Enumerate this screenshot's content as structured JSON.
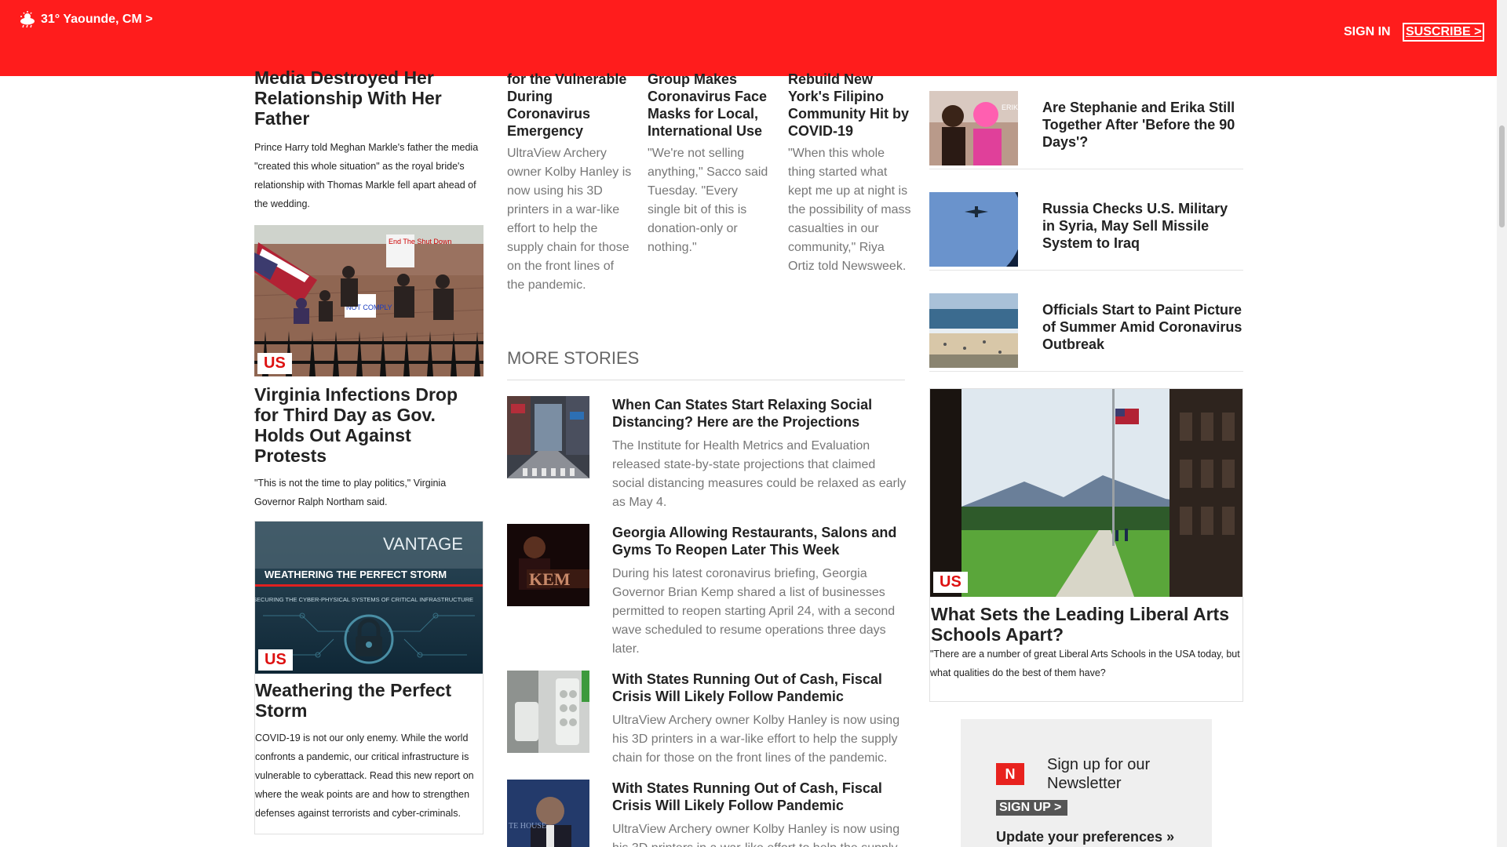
{
  "header": {
    "weather": "31° Yaounde, CM >",
    "sign_in": "SIGN IN",
    "subscribe": "SUSCRIBE >"
  },
  "left": {
    "story1": {
      "title": "Media Destroyed Her Relationship With Her Father",
      "summary": "Prince Harry told Meghan Markle's father the media \"created this whole situation\" as the royal bride's relationship with Thomas Markle fell apart ahead of the wedding."
    },
    "story2": {
      "tag": "US",
      "title": "Virginia Infections Drop for Third Day as Gov. Holds Out Against Protests",
      "summary": "\"This is not the time to play politics,\" Virginia Governor Ralph Northam said.",
      "sign_text": [
        "End The Shut Down",
        "NOT COMPLY"
      ]
    },
    "story3": {
      "tag": "US",
      "title": "Weathering the Perfect Storm",
      "summary": "COVID-19 is not our only enemy. While the world confronts a pandemic, our critical infrastructure is vulnerable to cyberattack. Read this new report on where the weak points are and how to strengthen defenses against terrorists and cyber-criminals.",
      "image_brand": "VANTAGE",
      "image_title": "WEATHERING THE PERFECT STORM",
      "image_subtitle": "SECURING THE CYBER-PHYSICAL SYSTEMS OF CRITICAL INFRASTRUCTURE"
    }
  },
  "middle": {
    "top_stories": [
      {
        "title": "for the Vulnerable During Coronavirus Emergency",
        "summary": "UltraView Archery owner Kolby Hanley is now using his 3D printers in a war-like effort to help the supply chain for those on the front lines of the pandemic."
      },
      {
        "title": "Group Makes Coronavirus Face Masks for Local, International Use",
        "summary": "\"We're not selling anything,\" Sacco said Tuesday. \"Every single bit of this is donation-only or nothing.\""
      },
      {
        "title": "Rebuild New York's Filipino Community Hit by COVID-19",
        "summary": "\"When this whole thing started what kept me up at night is the possibility of mass casualties in our community,\" Riya Ortiz told Newsweek."
      }
    ],
    "more_stories_label": "MORE STORIES",
    "more_stories": [
      {
        "title": "When Can States Start Relaxing Social Distancing? Here are the Projections",
        "summary": "The Institute for Health Metrics and Evaluation released state-by-state projections that claimed social distancing measures could be relaxed as early as May 4."
      },
      {
        "title": "Georgia Allowing Restaurants, Salons and Gyms To Reopen Later This Week",
        "summary": "During his latest coronavirus briefing, Georgia Governor Brian Kemp shared a list of businesses permitted to reopen starting April 24, with a second wave scheduled to resume operations three days later.",
        "image_text": "KEM"
      },
      {
        "title": "With States Running Out of Cash, Fiscal Crisis Will Likely Follow Pandemic",
        "summary": "UltraView Archery owner Kolby Hanley is now using his 3D printers in a war-like effort to help the supply chain for those on the front lines of the pandemic."
      },
      {
        "title": "With States Running Out of Cash, Fiscal Crisis Will Likely Follow Pandemic",
        "summary": "UltraView Archery owner Kolby Hanley is now using his 3D printers in a war-like effort to help the supply",
        "image_text": "TE HOUSE"
      }
    ]
  },
  "right": {
    "items": [
      {
        "title": "Are Stephanie and Erika Still Together After 'Before the 90 Days'?",
        "image_text": "ERIK"
      },
      {
        "title": "Russia Checks U.S. Military in Syria, May Sell Missile System to Iraq"
      },
      {
        "title": "Officials Start to Paint Picture of Summer Amid Coronavirus Outbreak"
      }
    ],
    "feature": {
      "tag": "US",
      "title": "What Sets the Leading Liberal Arts Schools Apart?",
      "summary": "\"There are a number of great Liberal Arts Schools in the USA today, but what qualities do the best of them have?"
    },
    "newsletter": {
      "logo": "N",
      "title": "Sign up for our Newsletter",
      "button": "SIGN UP >",
      "preferences": "Update your preferences »"
    }
  },
  "colors": {
    "brand_red": "#ff1c1c",
    "tag_red": "#dd1111",
    "gray_text": "#777777"
  }
}
